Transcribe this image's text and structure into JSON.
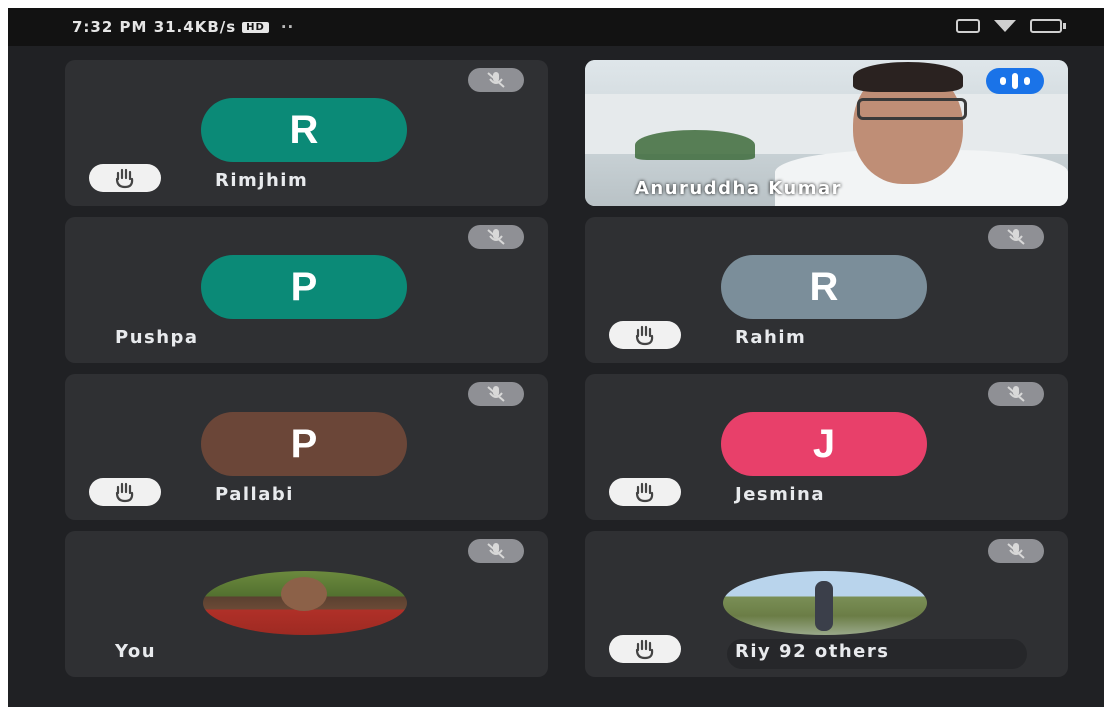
{
  "status_bar": {
    "time": "7:32 PM",
    "speed": "31.4KB/s",
    "badge": "HD",
    "dots": "··"
  },
  "participants": [
    {
      "name": "Rimjhim",
      "initial": "R",
      "color": "#0b8a77",
      "hand_raised": true,
      "muted": true
    },
    {
      "name": "Anuruddha Kumar",
      "video": true,
      "speaking": true
    },
    {
      "name": "Pushpa",
      "initial": "P",
      "color": "#0b8a77",
      "hand_raised": false,
      "muted": true
    },
    {
      "name": "Rahim",
      "initial": "R",
      "color": "#7b8e9a",
      "hand_raised": true,
      "muted": true
    },
    {
      "name": "Pallabi",
      "initial": "P",
      "color": "#6b4638",
      "hand_raised": true,
      "muted": true
    },
    {
      "name": "Jesmina",
      "initial": "J",
      "color": "#e8406a",
      "hand_raised": true,
      "muted": true
    },
    {
      "name": "You",
      "photo": true,
      "hand_raised": false,
      "muted": true
    },
    {
      "name": "Riy",
      "others_label": "92 others",
      "photo": true,
      "hand_raised": true,
      "muted": true
    }
  ],
  "colors": {
    "background": "#202124",
    "tile": "#2f3033",
    "speaking_badge": "#1a73e8"
  }
}
